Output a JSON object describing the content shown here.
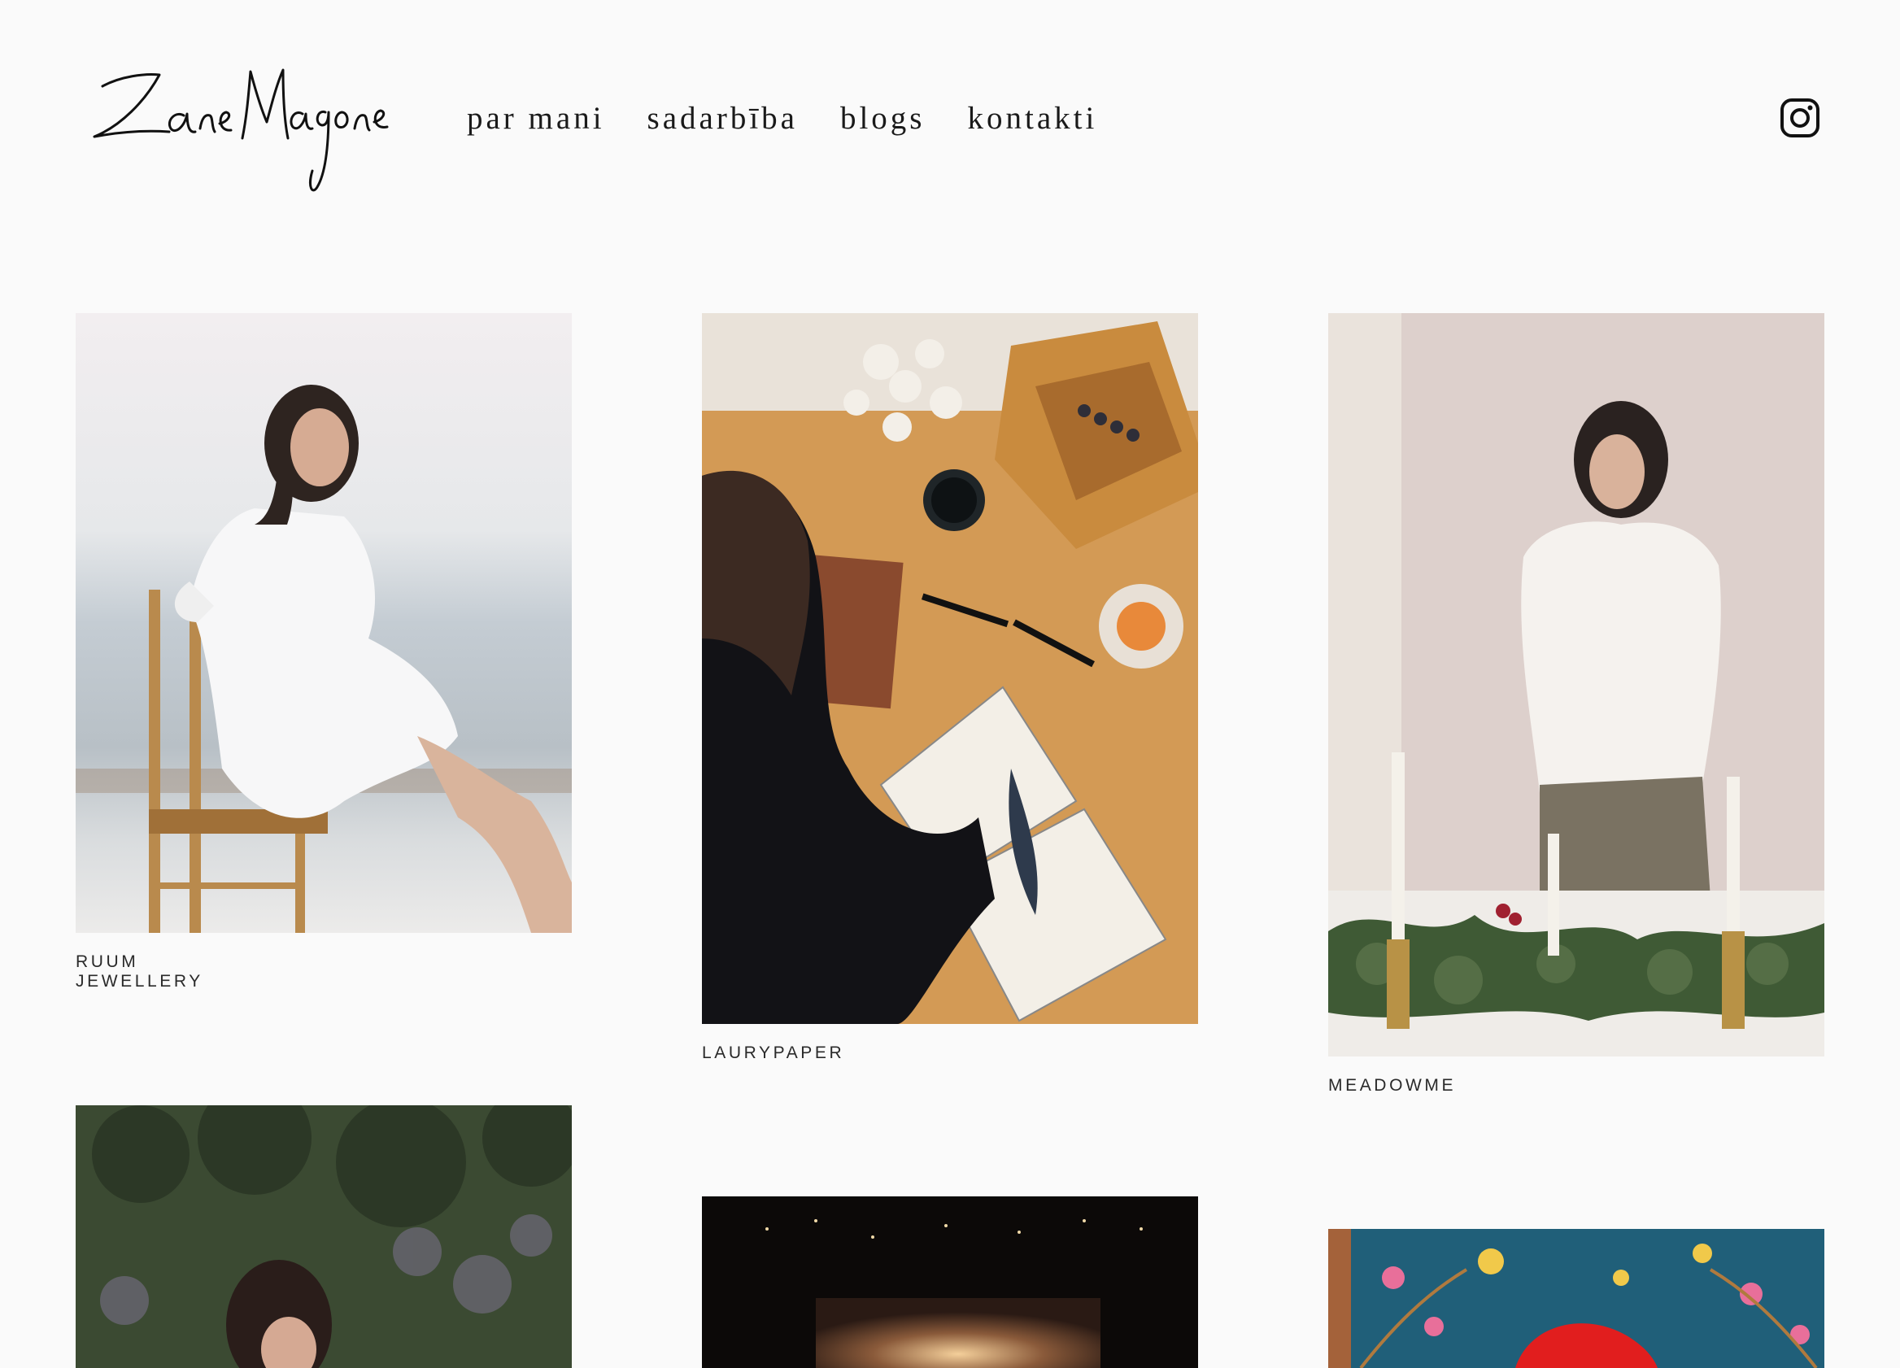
{
  "header": {
    "logo_text": "Zane Magone",
    "nav": [
      "par mani",
      "sadarbība",
      "blogs",
      "kontakti"
    ],
    "instagram_icon": "instagram-icon"
  },
  "portfolio": {
    "items": [
      {
        "caption": "RUUM JEWELLERY"
      },
      {
        "caption": "LAURYPAPER"
      },
      {
        "caption": "MEADOWME"
      },
      {
        "caption": ""
      },
      {
        "caption": ""
      },
      {
        "caption": ""
      }
    ]
  }
}
